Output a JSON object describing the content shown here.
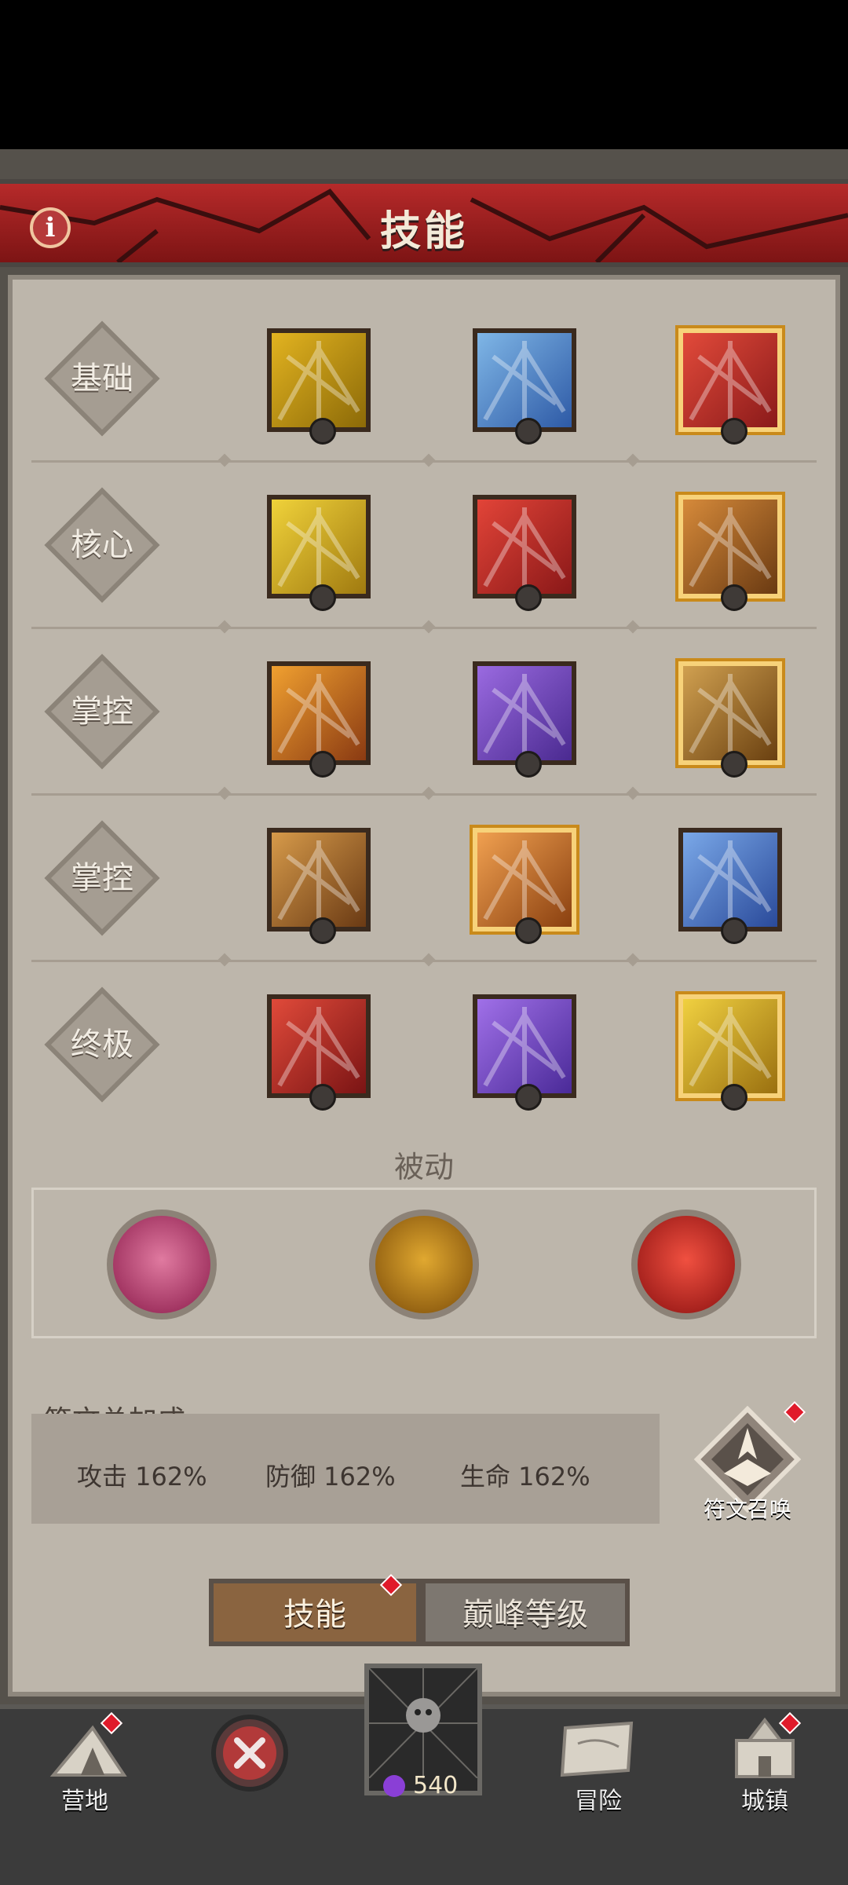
{
  "header": {
    "title": "技能",
    "info_icon": "info-icon"
  },
  "rows": [
    {
      "label": "基础",
      "skills": [
        {
          "colors": [
            "#e2b320",
            "#8c6a08"
          ],
          "icon": "golden-axe-icon",
          "selected": false
        },
        {
          "colors": [
            "#7fb6e6",
            "#2e5aa6"
          ],
          "icon": "frost-axe-icon",
          "selected": false
        },
        {
          "colors": [
            "#e24a3a",
            "#8a1a1a"
          ],
          "icon": "fire-hammer-icon",
          "selected": true
        }
      ]
    },
    {
      "label": "核心",
      "skills": [
        {
          "colors": [
            "#f0d23a",
            "#a07a10"
          ],
          "icon": "whirlwind-icon",
          "selected": false
        },
        {
          "colors": [
            "#e24438",
            "#8a1818"
          ],
          "icon": "rend-icon",
          "selected": false
        },
        {
          "colors": [
            "#d68a3a",
            "#6a3a12"
          ],
          "icon": "totem-icon",
          "selected": true
        }
      ]
    },
    {
      "label": "掌控",
      "skills": [
        {
          "colors": [
            "#f0a030",
            "#8a3a12"
          ],
          "icon": "fireball-icon",
          "selected": false
        },
        {
          "colors": [
            "#9a6ae0",
            "#4a2a90"
          ],
          "icon": "shockwave-icon",
          "selected": false
        },
        {
          "colors": [
            "#d0a050",
            "#6a4010"
          ],
          "icon": "earth-spike-icon",
          "selected": true
        }
      ]
    },
    {
      "label": "掌控",
      "skills": [
        {
          "colors": [
            "#d69a4a",
            "#6a3a14"
          ],
          "icon": "ground-slam-icon",
          "selected": false
        },
        {
          "colors": [
            "#f0a050",
            "#8a4010"
          ],
          "icon": "war-cry-icon",
          "selected": true
        },
        {
          "colors": [
            "#7aa8e8",
            "#2a4a9a"
          ],
          "icon": "frost-shout-icon",
          "selected": false
        }
      ]
    },
    {
      "label": "终极",
      "skills": [
        {
          "colors": [
            "#e04a3a",
            "#7a1414"
          ],
          "icon": "blood-claw-icon",
          "selected": false
        },
        {
          "colors": [
            "#a070e8",
            "#4a2a98"
          ],
          "icon": "demon-icon",
          "selected": false
        },
        {
          "colors": [
            "#f0d040",
            "#9a7010"
          ],
          "icon": "berserk-icon",
          "selected": true
        }
      ]
    }
  ],
  "passive": {
    "title": "被动",
    "skills": [
      {
        "icon": "bleeding-heart-icon",
        "colors": [
          "#e07aa0",
          "#8a1a4a"
        ]
      },
      {
        "icon": "horned-helmet-icon",
        "colors": [
          "#e0a830",
          "#7a4a08"
        ]
      },
      {
        "icon": "fire-skull-icon",
        "colors": [
          "#f05040",
          "#8a1010"
        ]
      }
    ]
  },
  "rune_bonus": {
    "title": "符文总加成",
    "stats": [
      "攻击  162%",
      "防御  162%",
      "生命  162%"
    ],
    "summon_label": "符文召唤"
  },
  "tabs": {
    "active": "技能",
    "inactive": "巅峰等级"
  },
  "nav": {
    "camp": "营地",
    "adventure": "冒险",
    "town": "城镇",
    "currency": "540"
  }
}
